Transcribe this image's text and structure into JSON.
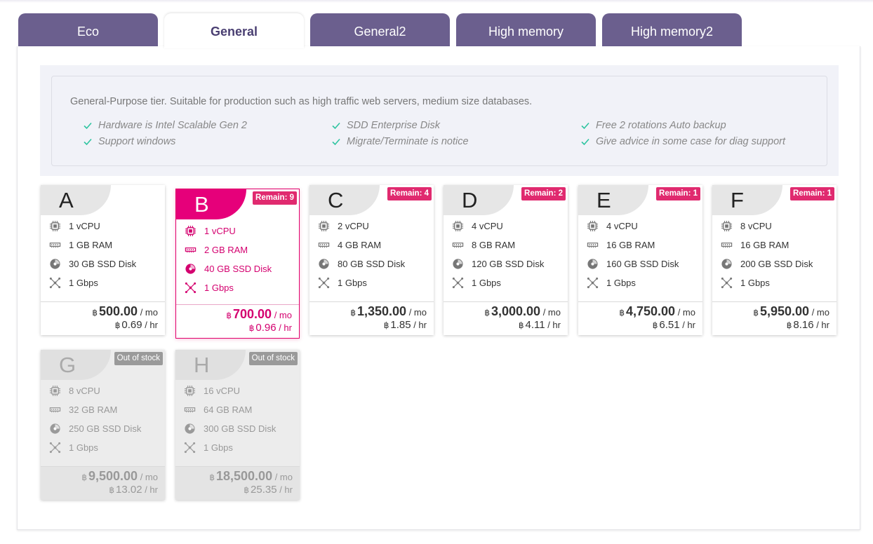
{
  "tabs": [
    {
      "label": "Eco",
      "active": false
    },
    {
      "label": "General",
      "active": true
    },
    {
      "label": "General2",
      "active": false
    },
    {
      "label": "High memory",
      "active": false
    },
    {
      "label": "High memory2",
      "active": false
    }
  ],
  "info": {
    "description": "General-Purpose tier. Suitable for production such as high traffic web servers, medium size databases.",
    "features": [
      "Hardware is Intel Scalable Gen 2",
      "Support windows",
      "SDD Enterprise Disk",
      "Migrate/Terminate is notice",
      "Free 2 rotations Auto backup",
      "Give advice in some case for diag support"
    ]
  },
  "colors": {
    "tab": "#6b5f8e",
    "accent": "#e6007a",
    "badge": "#e02a6f",
    "check": "#2ec4a0"
  },
  "currency": "฿",
  "per_month": "/ mo",
  "per_hour": "/ hr",
  "plans": [
    {
      "letter": "A",
      "badge": "",
      "cpu": "1 vCPU",
      "ram": "1 GB RAM",
      "disk": "30 GB SSD Disk",
      "net": "1 Gbps",
      "price_mo": "500.00",
      "price_hr": "0.69"
    },
    {
      "letter": "B",
      "badge": "Remain: 9",
      "cpu": "1 vCPU",
      "ram": "2 GB RAM",
      "disk": "40 GB SSD Disk",
      "net": "1 Gbps",
      "price_mo": "700.00",
      "price_hr": "0.96"
    },
    {
      "letter": "C",
      "badge": "Remain: 4",
      "cpu": "2 vCPU",
      "ram": "4 GB RAM",
      "disk": "80 GB SSD Disk",
      "net": "1 Gbps",
      "price_mo": "1,350.00",
      "price_hr": "1.85"
    },
    {
      "letter": "D",
      "badge": "Remain: 2",
      "cpu": "4 vCPU",
      "ram": "8 GB RAM",
      "disk": "120 GB SSD Disk",
      "net": "1 Gbps",
      "price_mo": "3,000.00",
      "price_hr": "4.11"
    },
    {
      "letter": "E",
      "badge": "Remain: 1",
      "cpu": "4 vCPU",
      "ram": "16 GB RAM",
      "disk": "160 GB SSD Disk",
      "net": "1 Gbps",
      "price_mo": "4,750.00",
      "price_hr": "6.51"
    },
    {
      "letter": "F",
      "badge": "Remain: 1",
      "cpu": "8 vCPU",
      "ram": "16 GB RAM",
      "disk": "200 GB SSD Disk",
      "net": "1 Gbps",
      "price_mo": "5,950.00",
      "price_hr": "8.16"
    },
    {
      "letter": "G",
      "badge": "Out of stock",
      "cpu": "8 vCPU",
      "ram": "32 GB RAM",
      "disk": "250 GB SSD Disk",
      "net": "1 Gbps",
      "price_mo": "9,500.00",
      "price_hr": "13.02"
    },
    {
      "letter": "H",
      "badge": "Out of stock",
      "cpu": "16 vCPU",
      "ram": "64 GB RAM",
      "disk": "300 GB SSD Disk",
      "net": "1 Gbps",
      "price_mo": "18,500.00",
      "price_hr": "25.35"
    }
  ]
}
